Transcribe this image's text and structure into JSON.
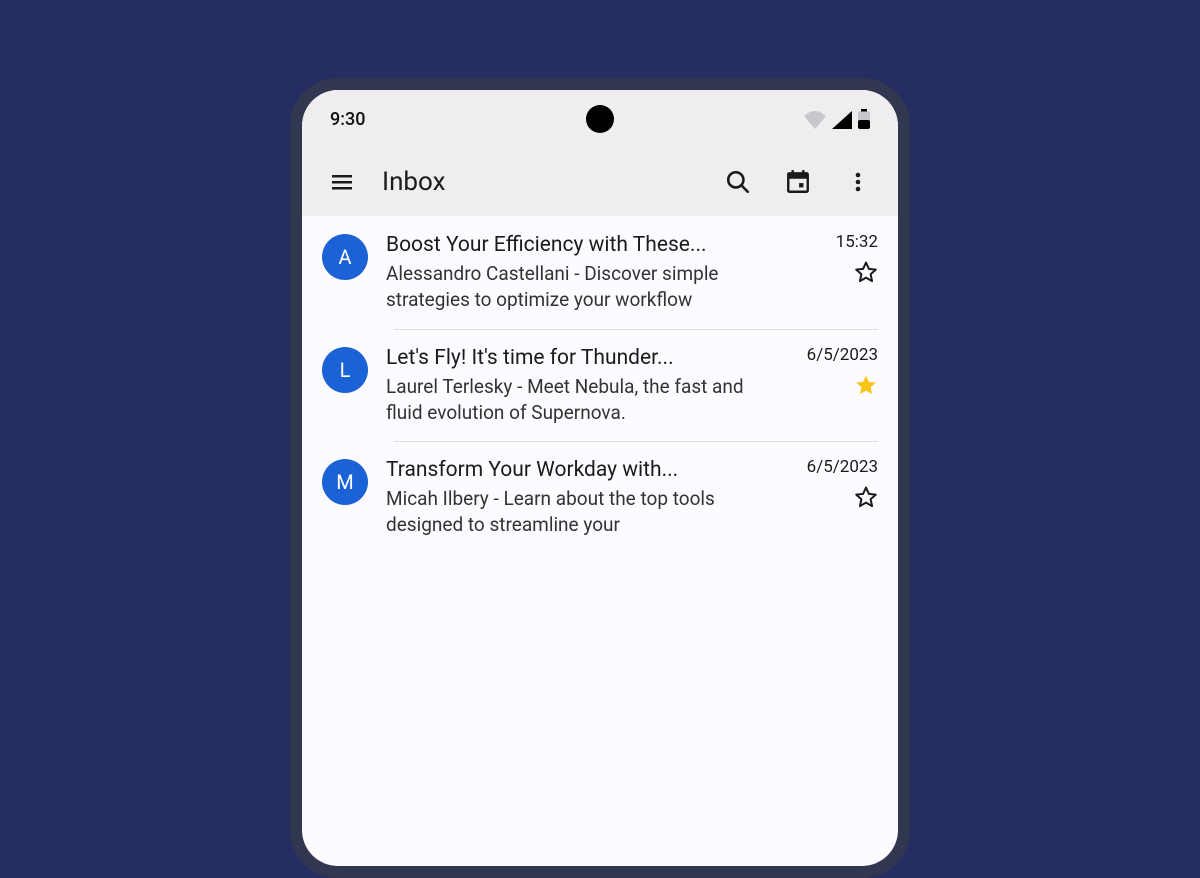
{
  "statusbar": {
    "time": "9:30"
  },
  "appbar": {
    "title": "Inbox"
  },
  "messages": [
    {
      "avatar": "A",
      "subject": "Boost Your Efficiency with These...",
      "preview": "Alessandro Castellani - Discover simple strategies to optimize your workflow",
      "date": "15:32",
      "starred": false
    },
    {
      "avatar": "L",
      "subject": "Let's Fly! It's time for Thunder...",
      "preview": "Laurel Terlesky - Meet Nebula, the fast and fluid evolution of Supernova.",
      "date": "6/5/2023",
      "starred": true
    },
    {
      "avatar": "M",
      "subject": "Transform Your Workday with...",
      "preview": "Micah Ilbery - Learn about the top tools designed to streamline your",
      "date": "6/5/2023",
      "starred": false
    }
  ]
}
